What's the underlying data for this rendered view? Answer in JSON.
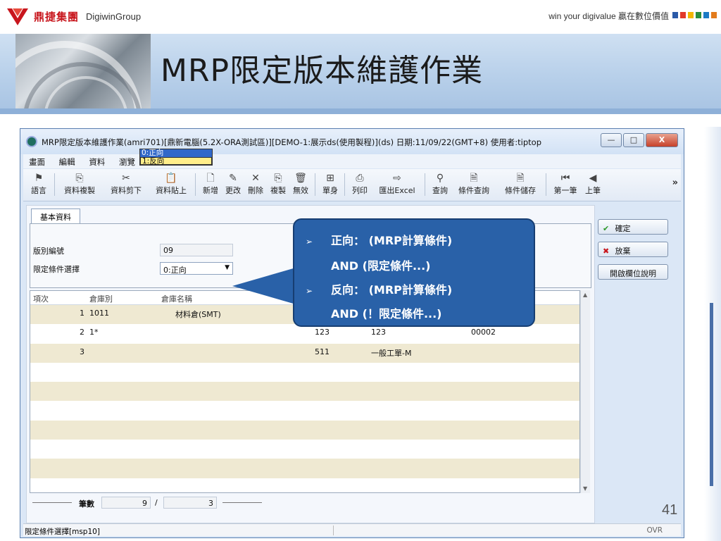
{
  "slide": {
    "logo_cn": "鼎捷集團",
    "logo_en": "DigiwinGroup",
    "slogan": "win your digivalue 贏在數位價值",
    "title": "MRP限定版本維護作業",
    "page_number": "41",
    "slogan_colors": [
      "#2a5aa8",
      "#e23a2a",
      "#f2b600",
      "#2a8d3c",
      "#1b7ac4",
      "#e37b1c"
    ]
  },
  "window": {
    "title": "MRP限定版本維護作業(amri701)[鼎新電腦(5.2X-ORA測試區)][DEMO-1:展示ds(使用製程)](ds) 日期:11/09/22(GMT+8) 使用者:tiptop",
    "buttons": {
      "minimize": "—",
      "maximize": "□",
      "close": "X"
    }
  },
  "menu": [
    "畫面",
    "編輯",
    "資料",
    "瀏覽"
  ],
  "toolbar": {
    "items": [
      {
        "label": "語言",
        "icon": "⚑"
      },
      {
        "label": "資料複製",
        "icon": "⎘"
      },
      {
        "label": "資料剪下",
        "icon": "✂"
      },
      {
        "label": "資料貼上",
        "icon": "📋"
      },
      {
        "label": "新增",
        "icon": "🗋"
      },
      {
        "label": "更改",
        "icon": "✎"
      },
      {
        "label": "刪除",
        "icon": "✕"
      },
      {
        "label": "複製",
        "icon": "⎘"
      },
      {
        "label": "無效",
        "icon": "🗑"
      },
      {
        "label": "單身",
        "icon": "⊞"
      },
      {
        "label": "列印",
        "icon": "⎙"
      },
      {
        "label": "匯出Excel",
        "icon": "⇨"
      },
      {
        "label": "查詢",
        "icon": "⚲"
      },
      {
        "label": "條件查詢",
        "icon": "🗎"
      },
      {
        "label": "條件儲存",
        "icon": "🗎"
      },
      {
        "label": "第一筆",
        "icon": "⏮"
      },
      {
        "label": "上筆",
        "icon": "◀"
      }
    ],
    "more": "»"
  },
  "form": {
    "tab_label": "基本資料",
    "version_label": "版別編號",
    "version_value": "09",
    "condition_label": "限定條件選擇",
    "condition_value": "0:正向",
    "dropdown_options": [
      "0:正向",
      "1:反向"
    ]
  },
  "grid": {
    "headers": [
      "項次",
      "倉庫別",
      "倉庫名稱"
    ],
    "rows": [
      {
        "seq": "1",
        "warehouse": "1011",
        "name": "材料倉(SMT)",
        "c4": "",
        "c5": "",
        "c6": ""
      },
      {
        "seq": "2",
        "warehouse": "1*",
        "name": "",
        "c4": "123",
        "c5": "123",
        "c6": "00002"
      },
      {
        "seq": "3",
        "warehouse": "",
        "name": "",
        "c4": "511",
        "c5": "一般工單-M",
        "c6": ""
      }
    ],
    "empty_rows": 7
  },
  "counter": {
    "label": "筆數",
    "total": "9",
    "separator": "/",
    "current": "3"
  },
  "side_buttons": {
    "confirm": "確定",
    "cancel": "放棄",
    "help": "開啟欄位說明"
  },
  "status": {
    "left": "限定條件選擇[msp10]",
    "right": "OVR"
  },
  "callout": {
    "bullet": "➢",
    "line1_a": "正向：",
    "line1_b": "(MRP計算條件)",
    "line2": "AND (限定條件...)",
    "line3_a": "反向：",
    "line3_b": "(MRP計算條件)",
    "line4": "AND (！限定條件...)"
  }
}
